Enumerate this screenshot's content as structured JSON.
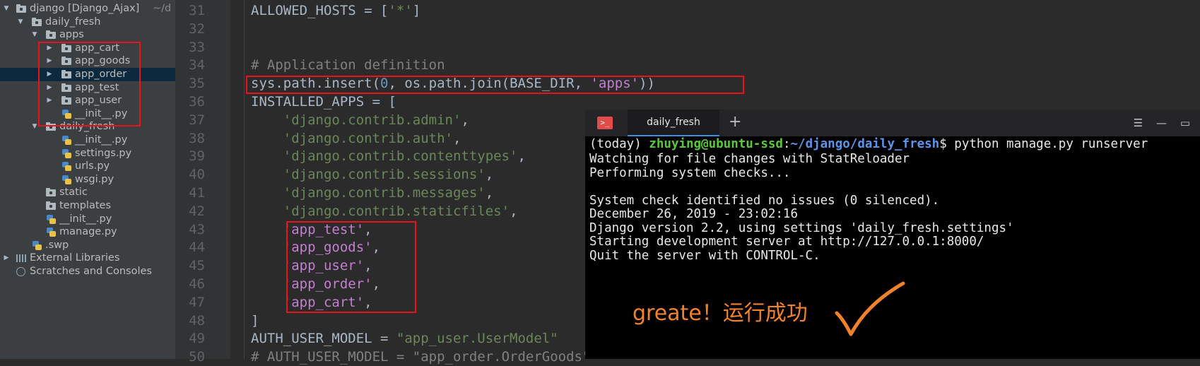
{
  "project_tree": {
    "items": [
      {
        "label": "django [Django_Ajax]",
        "suffix": "~/d",
        "type": "folder",
        "arrow": "▼"
      },
      {
        "label": "daily_fresh",
        "type": "folder",
        "arrow": "▼"
      },
      {
        "label": "apps",
        "type": "folder",
        "arrow": "▼"
      },
      {
        "label": "app_cart",
        "type": "folder",
        "arrow": "▶"
      },
      {
        "label": "app_goods",
        "type": "folder",
        "arrow": "▶"
      },
      {
        "label": "app_order",
        "type": "folder",
        "arrow": "▶",
        "selected": true
      },
      {
        "label": "app_test",
        "type": "folder",
        "arrow": "▶"
      },
      {
        "label": "app_user",
        "type": "folder",
        "arrow": "▶"
      },
      {
        "label": "__init__.py",
        "type": "python"
      },
      {
        "label": "daily_fresh",
        "type": "folder",
        "arrow": "▼"
      },
      {
        "label": "__init__.py",
        "type": "python"
      },
      {
        "label": "settings.py",
        "type": "python"
      },
      {
        "label": "urls.py",
        "type": "python"
      },
      {
        "label": "wsgi.py",
        "type": "python"
      },
      {
        "label": "static",
        "type": "folder"
      },
      {
        "label": "templates",
        "type": "folder"
      },
      {
        "label": "__init__.py",
        "type": "python"
      },
      {
        "label": "manage.py",
        "type": "python"
      },
      {
        "label": ".swp",
        "type": "python"
      },
      {
        "label": "External Libraries",
        "type": "library",
        "arrow": "▶"
      },
      {
        "label": "Scratches and Consoles",
        "type": "scratches"
      }
    ]
  },
  "editor": {
    "line_numbers": [
      "31",
      "32",
      "33",
      "34",
      "35",
      "36",
      "37",
      "38",
      "39",
      "40",
      "41",
      "42",
      "43",
      "44",
      "45",
      "46",
      "47",
      "48",
      "49",
      "50"
    ],
    "lines": [
      [
        {
          "t": "ALLOWED_HOSTS = [",
          "c": ""
        },
        {
          "t": "'*'",
          "c": "str"
        },
        {
          "t": "]",
          "c": ""
        }
      ],
      [],
      [],
      [
        {
          "t": "# Application definition",
          "c": "cmt"
        }
      ],
      [
        {
          "t": "sys.path.insert(",
          "c": ""
        },
        {
          "t": "0",
          "c": "num"
        },
        {
          "t": ", os.path.join(BASE_DIR, ",
          "c": ""
        },
        {
          "t": "'apps'",
          "c": "str2"
        },
        {
          "t": "))",
          "c": ""
        }
      ],
      [
        {
          "t": "INSTALLED_APPS = [",
          "c": ""
        }
      ],
      [
        {
          "t": "    ",
          "c": ""
        },
        {
          "t": "'django.contrib.admin'",
          "c": "str"
        },
        {
          "t": ",",
          "c": ""
        }
      ],
      [
        {
          "t": "    ",
          "c": ""
        },
        {
          "t": "'django.contrib.auth'",
          "c": "str"
        },
        {
          "t": ",",
          "c": ""
        }
      ],
      [
        {
          "t": "    ",
          "c": ""
        },
        {
          "t": "'django.contrib.contenttypes'",
          "c": "str"
        },
        {
          "t": ",",
          "c": ""
        }
      ],
      [
        {
          "t": "    ",
          "c": ""
        },
        {
          "t": "'django.contrib.sessions'",
          "c": "str"
        },
        {
          "t": ",",
          "c": ""
        }
      ],
      [
        {
          "t": "    ",
          "c": ""
        },
        {
          "t": "'django.contrib.messages'",
          "c": "str"
        },
        {
          "t": ",",
          "c": ""
        }
      ],
      [
        {
          "t": "    ",
          "c": ""
        },
        {
          "t": "'django.contrib.staticfiles'",
          "c": "str"
        },
        {
          "t": ",",
          "c": ""
        }
      ],
      [
        {
          "t": "    ",
          "c": ""
        },
        {
          "t": "'app_test'",
          "c": "str2"
        },
        {
          "t": ",",
          "c": ""
        }
      ],
      [
        {
          "t": "    ",
          "c": ""
        },
        {
          "t": "'app_goods'",
          "c": "str2"
        },
        {
          "t": ",",
          "c": ""
        }
      ],
      [
        {
          "t": "    ",
          "c": ""
        },
        {
          "t": "'app_user'",
          "c": "str2"
        },
        {
          "t": ",",
          "c": ""
        }
      ],
      [
        {
          "t": "    ",
          "c": ""
        },
        {
          "t": "'app_order'",
          "c": "str2"
        },
        {
          "t": ",",
          "c": ""
        }
      ],
      [
        {
          "t": "    ",
          "c": ""
        },
        {
          "t": "'app_cart'",
          "c": "str2"
        },
        {
          "t": ",",
          "c": ""
        }
      ],
      [
        {
          "t": "]",
          "c": ""
        }
      ],
      [
        {
          "t": "AUTH_USER_MODEL = ",
          "c": ""
        },
        {
          "t": "\"app_user.UserModel\"",
          "c": "str"
        }
      ],
      [
        {
          "t": "# AUTH_USER_MODEL = \"app_order.OrderGoods\"",
          "c": "cmt"
        }
      ]
    ]
  },
  "terminal": {
    "tab_label": "daily_fresh",
    "add_tab": "+",
    "controls": [
      "☰",
      "—",
      "▭"
    ],
    "prompt_env": "(today) ",
    "prompt_user": "zhuying@ubuntu-ssd",
    "prompt_sep": ":",
    "prompt_path": "~/django/daily_fresh",
    "prompt_cmd": "$ python manage.py runserver",
    "output": [
      "Watching for file changes with StatReloader",
      "Performing system checks...",
      "",
      "System check identified no issues (0 silenced).",
      "December 26, 2019 - 23:02:16",
      "Django version 2.2, using settings 'daily_fresh.settings'",
      "Starting development server at http://127.0.0.1:8000/",
      "Quit the server with CONTROL-C."
    ]
  },
  "annotation": {
    "note": "greate！运行成功",
    "note_color": "#f0822a",
    "highlight_color": "#e8141b"
  }
}
